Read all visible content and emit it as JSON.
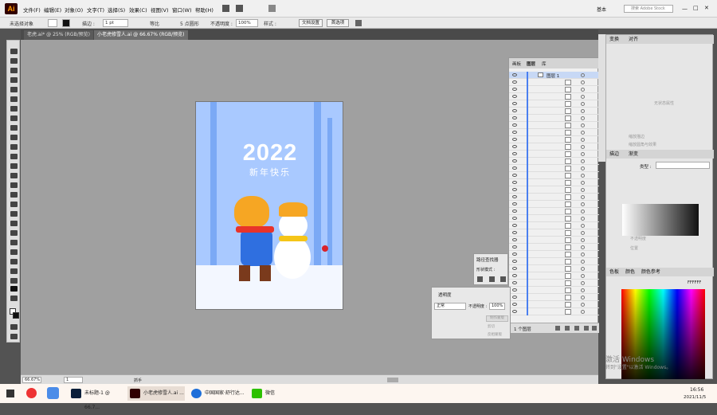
{
  "menubar": {
    "logo": "Ai",
    "items": [
      "文件(F)",
      "编辑(E)",
      "对象(O)",
      "文字(T)",
      "选择(S)",
      "效果(C)",
      "视图(V)",
      "窗口(W)",
      "帮助(H)"
    ],
    "workspace": "基本",
    "search_placeholder": "搜索 Adobe Stock"
  },
  "control": {
    "no_selection": "未选择对象",
    "stroke_label": "描边 :",
    "stroke_value": "1 pt",
    "profile": "等比",
    "brush": "5 点圆形",
    "opacity_label": "不透明度 :",
    "opacity_value": "100%",
    "style_label": "样式 :",
    "doc_setup": "文档设置",
    "prefs": "首选项"
  },
  "tabs": [
    {
      "label": "老虎.ai* @ 25% (RGB/预览)"
    },
    {
      "label": "小老虎修雪人.ai @ 66.67% (RGB/预览)"
    }
  ],
  "artboard": {
    "year": "2022",
    "greeting": "新年快乐"
  },
  "layers_panel": {
    "tabs": [
      "画板",
      "图层",
      "库"
    ],
    "layer_name": "图层 1",
    "footer": "1 个图层"
  },
  "transform_panel": {
    "tabs": [
      "变换",
      "对齐"
    ],
    "no_selection": "无状态属性",
    "opt1": "缩放描边",
    "opt2": "缩放圆角与效果"
  },
  "gradient_panel": {
    "tabs": [
      "描边",
      "渐变"
    ],
    "type_label": "类型 :"
  },
  "appearance_panel": {
    "opacity_label": "不透明度",
    "position_label": "位置"
  },
  "color_panel": {
    "tabs": [
      "色板",
      "颜色",
      "颜色参考"
    ],
    "hex": "FFFFFF"
  },
  "pathfinder_panel": {
    "title": "路径查找器",
    "shape_modes": "形状模式 :"
  },
  "transparency_panel": {
    "title": "透明度",
    "mode": "正常",
    "opacity_label": "不透明度 :",
    "opacity_value": "100%",
    "btn": "制作蒙版",
    "opt1": "剪切",
    "opt2": "反相蒙版"
  },
  "statusbar": {
    "zoom": "66.67%",
    "page": "1",
    "tool": "抓手"
  },
  "watermark": {
    "line1": "激活 Windows",
    "line2": "转到\"设置\"以激活 Windows。"
  },
  "taskbar": {
    "items": [
      "未标题-1 @ 66.7...",
      "小老虎修雪人.ai ...",
      "中国国家·舒行达...",
      "微信"
    ],
    "time": "16:56",
    "date": "2021/11/5"
  },
  "colors": {
    "accent": "#4a7ff0",
    "sky": "#a9c9ff",
    "ai_orange": "#ff9a00"
  }
}
